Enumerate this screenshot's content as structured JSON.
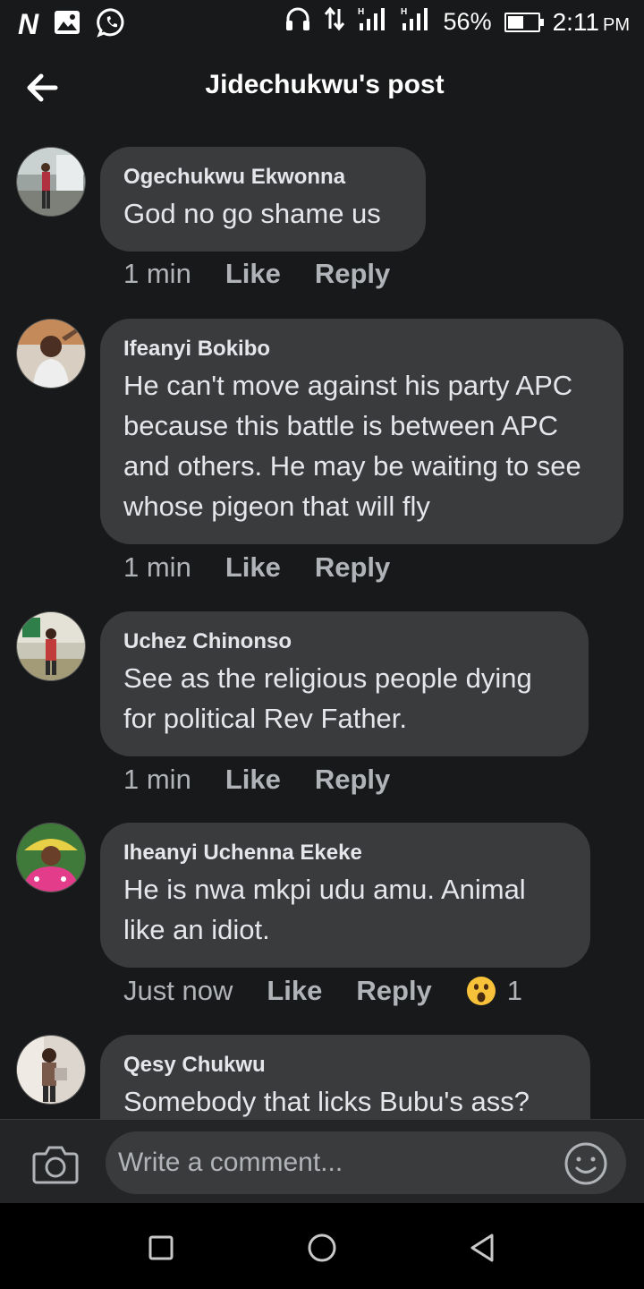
{
  "status_bar": {
    "battery_percent": "56%",
    "time": "2:11",
    "ampm": "PM",
    "battery_level": 0.56,
    "icons": [
      "n-icon",
      "gallery-icon",
      "whatsapp-icon",
      "headphones-icon",
      "data-arrows-icon",
      "signal-icon",
      "signal-icon",
      "battery-icon"
    ]
  },
  "header": {
    "title": "Jidechukwu's post",
    "back_icon": "arrow-left-icon"
  },
  "comments": [
    {
      "name": "Ogechukwu Ekwonna",
      "text": "God no go shame us",
      "time": "1 min",
      "like": "Like",
      "reply": "Reply"
    },
    {
      "name": "Ifeanyi Bokibo",
      "text": "He can't move against his party APC because this battle is between APC and others. He may be waiting to see whose pigeon that will fly",
      "time": "1 min",
      "like": "Like",
      "reply": "Reply"
    },
    {
      "name": "Uchez Chinonso",
      "text": "See as the religious people dying for political Rev Father.",
      "time": "1 min",
      "like": "Like",
      "reply": "Reply"
    },
    {
      "name": "Iheanyi Uchenna Ekeke",
      "text": "He is nwa mkpi udu amu. Animal like an idiot.",
      "time": "Just now",
      "like": "Like",
      "reply": "Reply",
      "reaction_icon": "wow-emoji-icon",
      "reaction_count": "1"
    },
    {
      "name": "Qesy Chukwu",
      "text": "Somebody that licks Bubu's ass?"
    }
  ],
  "composer": {
    "placeholder": "Write a comment...",
    "camera_icon": "camera-icon",
    "emoji_icon": "smiley-icon"
  },
  "navbar": {
    "icons": [
      "recents-square-icon",
      "home-circle-icon",
      "back-triangle-icon"
    ]
  },
  "colors": {
    "background": "#18191a",
    "bubble": "#3a3b3c",
    "text": "#e4e6eb",
    "secondary_text": "#b0b3b8"
  }
}
